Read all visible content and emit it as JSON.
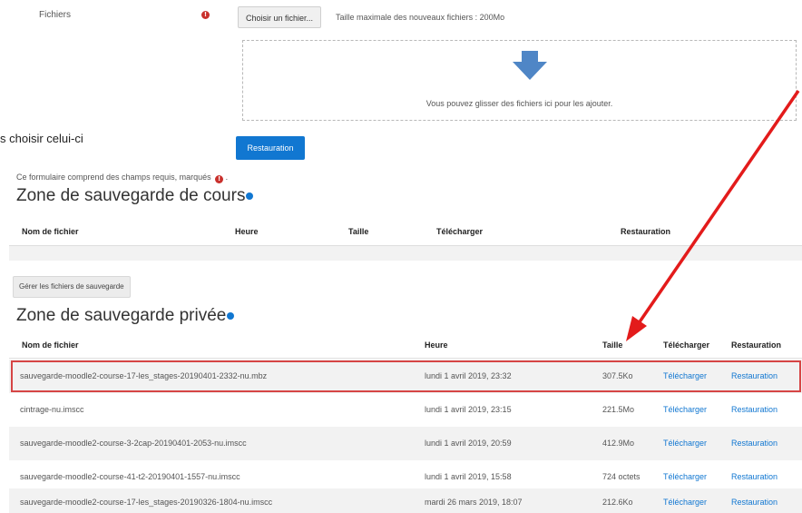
{
  "upload": {
    "field_label": "Fichiers",
    "required_icon": "exclamation-circle-icon",
    "choose_button": "Choisir un fichier...",
    "max_size_text": "Taille maximale des nouveaux fichiers : 200Mo",
    "dropzone_icon": "down-arrow-icon",
    "dropzone_text": "Vous pouvez glisser des fichiers ici pour les ajouter."
  },
  "side_text": "s choisir celui-ci",
  "restore_button": "Restauration",
  "form_note": "Ce formulaire comprend des champs requis, marqués",
  "form_note_end": ".",
  "course_zone": {
    "title": "Zone de sauvegarde de cours",
    "headers": {
      "filename": "Nom de fichier",
      "time": "Heure",
      "size": "Taille",
      "download": "Télécharger",
      "restore": "Restauration"
    }
  },
  "manage_button": "Gérer les fichiers de sauvegarde",
  "private_zone": {
    "title": "Zone de sauvegarde privée",
    "headers": {
      "filename": "Nom de fichier",
      "time": "Heure",
      "size": "Taille",
      "download": "Télécharger",
      "restore": "Restauration"
    },
    "rows": [
      {
        "filename": "sauvegarde-moodle2-course-17-les_stages-20190401-2332-nu.mbz",
        "time": "lundi 1 avril 2019, 23:32",
        "size": "307.5Ko",
        "download": "Télécharger",
        "restore": "Restauration"
      },
      {
        "filename": "cintrage-nu.imscc",
        "time": "lundi 1 avril 2019, 23:15",
        "size": "221.5Mo",
        "download": "Télécharger",
        "restore": "Restauration"
      },
      {
        "filename": "sauvegarde-moodle2-course-3-2cap-20190401-2053-nu.imscc",
        "time": "lundi 1 avril 2019, 20:59",
        "size": "412.9Mo",
        "download": "Télécharger",
        "restore": "Restauration"
      },
      {
        "filename": "sauvegarde-moodle2-course-41-t2-20190401-1557-nu.imscc",
        "time": "lundi 1 avril 2019, 15:58",
        "size": "724 octets",
        "download": "Télécharger",
        "restore": "Restauration"
      },
      {
        "filename": "sauvegarde-moodle2-course-17-les_stages-20190326-1804-nu.imscc",
        "time": "mardi 26 mars 2019, 18:07",
        "size": "212.6Ko",
        "download": "Télécharger",
        "restore": "Restauration"
      }
    ]
  },
  "annotation": {
    "color": "#e31b1b",
    "highlight_color": "#d64545"
  },
  "colors": {
    "primary": "#1177d1",
    "required": "#c9302c"
  }
}
